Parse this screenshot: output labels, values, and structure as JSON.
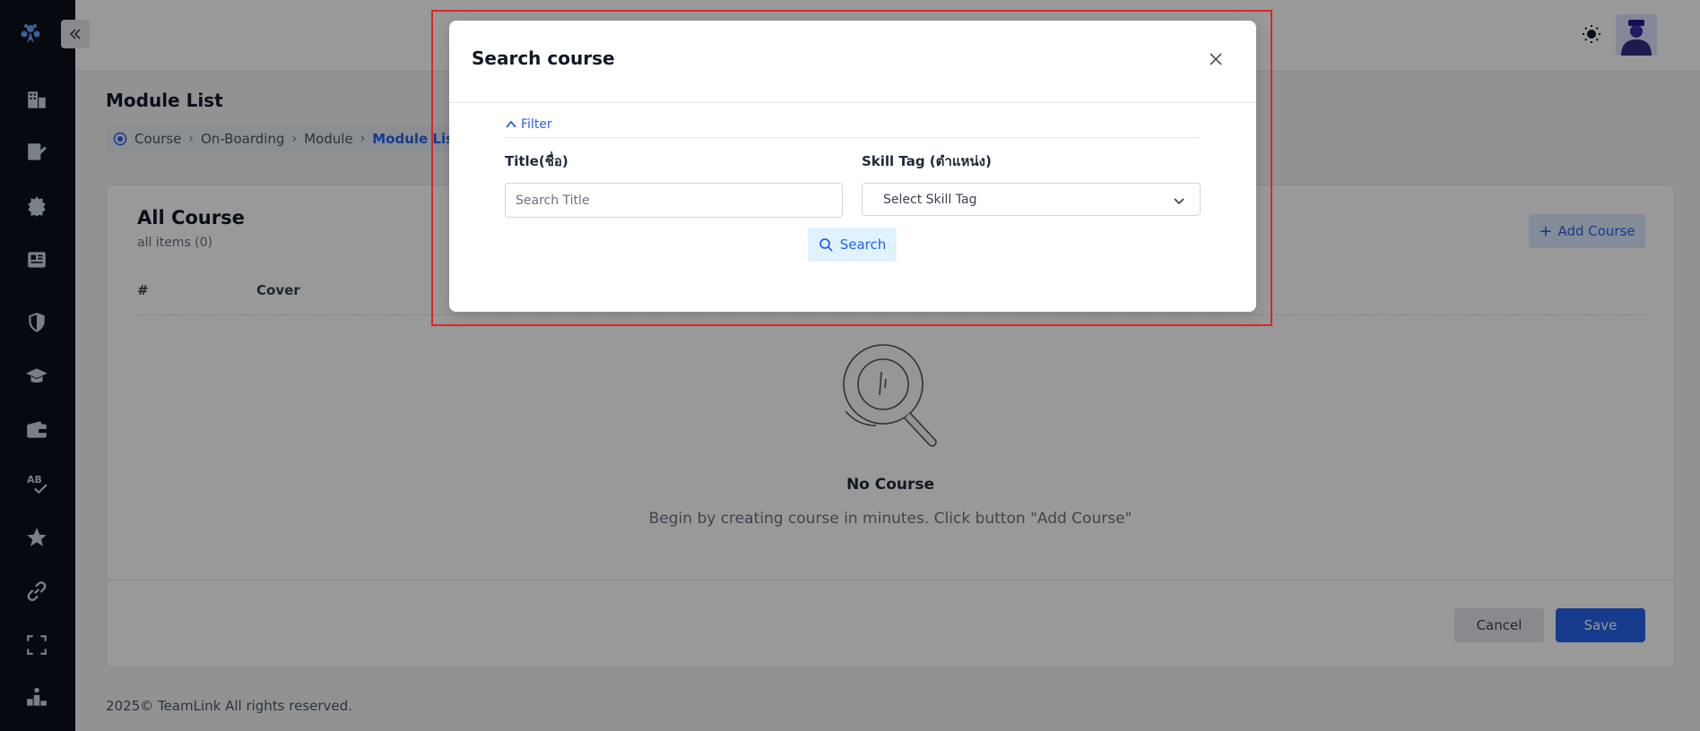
{
  "sidebar": {
    "logo": "teamlink-logo",
    "items": [
      {
        "icon": "building-icon"
      },
      {
        "icon": "signature-icon"
      },
      {
        "icon": "gear-badge-icon"
      },
      {
        "icon": "newspaper-icon"
      },
      {
        "icon": "shield-icon"
      },
      {
        "icon": "graduation-cap-icon"
      },
      {
        "icon": "wallet-icon"
      },
      {
        "icon": "spell-check-icon"
      },
      {
        "icon": "star-icon"
      },
      {
        "icon": "link-icon"
      },
      {
        "icon": "fullscreen-icon"
      },
      {
        "icon": "podium-icon"
      }
    ]
  },
  "page": {
    "title": "Module List",
    "breadcrumb": [
      "Course",
      "On-Boarding",
      "Module",
      "Module List"
    ]
  },
  "card": {
    "title": "All Course",
    "subtitle": "all items (0)",
    "add_button": "Add Course",
    "columns": [
      "#",
      "Cover"
    ],
    "empty_title": "No Course",
    "empty_desc": "Begin by creating course in minutes. Click button \"Add Course\"",
    "cancel_label": "Cancel",
    "save_label": "Save"
  },
  "footer": {
    "text": "2025© TeamLink All rights reserved."
  },
  "modal": {
    "title": "Search course",
    "filter_label": "Filter",
    "title_label": "Title(ชื่อ)",
    "title_placeholder": "Search Title",
    "skill_label": "Skill Tag (ตำแหน่ง)",
    "skill_placeholder": "Select Skill Tag",
    "search_label": "Search"
  },
  "colors": {
    "accent": "#2563eb",
    "sidebar_bg": "#0b0f19",
    "highlight": "#e02424"
  }
}
